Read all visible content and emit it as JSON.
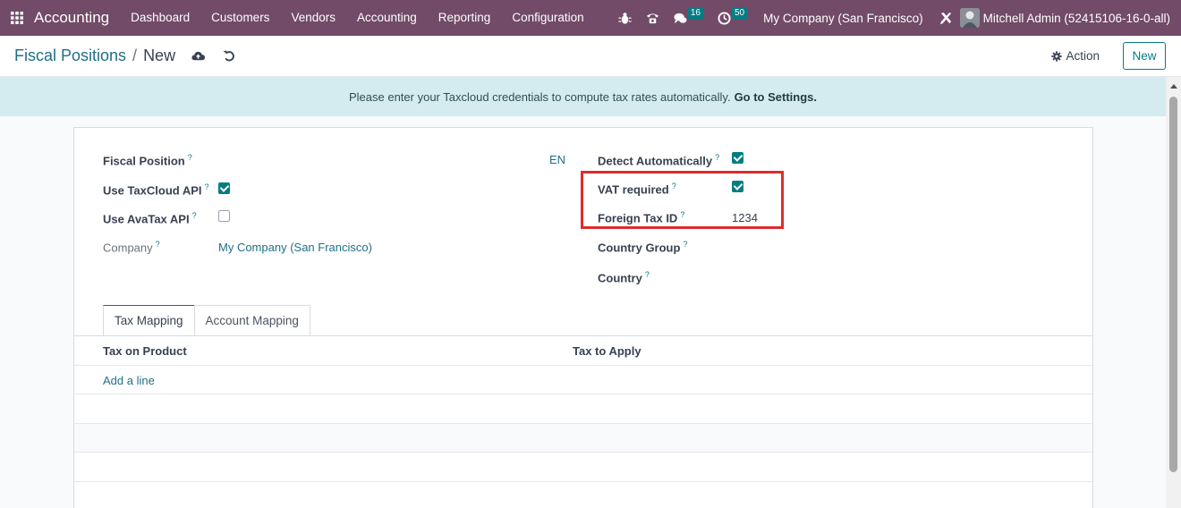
{
  "navbar": {
    "app_name": "Accounting",
    "menu": [
      "Dashboard",
      "Customers",
      "Vendors",
      "Accounting",
      "Reporting",
      "Configuration"
    ],
    "chat_count": "16",
    "activity_count": "50",
    "company": "My Company (San Francisco)",
    "user": "Mitchell Admin (52415106-16-0-all)"
  },
  "breadcrumb": {
    "parent": "Fiscal Positions",
    "separator": "/",
    "current": "New"
  },
  "control": {
    "action_label": "Action",
    "new_label": "New"
  },
  "alert": {
    "message": "Please enter your Taxcloud credentials to compute tax rates automatically.",
    "link": "Go to Settings."
  },
  "form": {
    "fiscal_position_label": "Fiscal Position",
    "fiscal_position_lang": "EN",
    "use_taxcloud_label": "Use TaxCloud API",
    "use_taxcloud": true,
    "use_avatax_label": "Use AvaTax API",
    "use_avatax": false,
    "company_label": "Company",
    "company_value": "My Company (San Francisco)",
    "detect_auto_label": "Detect Automatically",
    "detect_auto": true,
    "vat_required_label": "VAT required",
    "vat_required": true,
    "foreign_tax_id_label": "Foreign Tax ID",
    "foreign_tax_id": "1234",
    "country_group_label": "Country Group",
    "country_label": "Country",
    "help_mark": "?"
  },
  "tabs": [
    "Tax Mapping",
    "Account Mapping"
  ],
  "table": {
    "columns": [
      "Tax on Product",
      "Tax to Apply"
    ],
    "add_line": "Add a line"
  },
  "colors": {
    "navbar": "#714b67",
    "accent": "#017e84",
    "alert_bg": "#d4ecef",
    "highlight": "#e02b2b"
  }
}
